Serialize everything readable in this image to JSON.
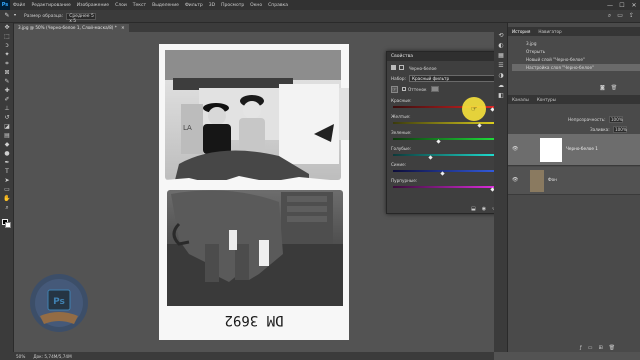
{
  "menubar": {
    "logo": "Ps",
    "items": [
      "Файл",
      "Редактирование",
      "Изображение",
      "Слои",
      "Текст",
      "Выделение",
      "Фильтр",
      "3D",
      "Просмотр",
      "Окно",
      "Справка"
    ],
    "window_controls": [
      "—",
      "☐",
      "✕"
    ]
  },
  "optionsbar": {
    "size_label": "Размер образца:",
    "size_value": "Среднее 5 x 5"
  },
  "document_tab": {
    "title": "3.jpg @ 50% (Черно-белое 1, Слой-маска/8) *",
    "close": "✕"
  },
  "properties": {
    "title": "Свойства",
    "close": "✕",
    "layer_type": "Черно-белое",
    "preset_label": "Набор:",
    "preset_value": "Красный фильтр",
    "tint_label": "Оттенок",
    "auto_label": "Авто",
    "sliders": [
      {
        "label": "Красные:",
        "value": "121",
        "gradient": [
          "#3a0d0d",
          "#ff2a2a"
        ],
        "fraction": 0.8
      },
      {
        "label": "Желтые:",
        "value": "110",
        "gradient": [
          "#3a3a0d",
          "#ffee22"
        ],
        "fraction": 0.7
      },
      {
        "label": "Зеленые:",
        "value": "-10",
        "gradient": [
          "#0d3a0d",
          "#22ff44"
        ],
        "fraction": 0.37
      },
      {
        "label": "Голубые:",
        "value": "-50",
        "gradient": [
          "#0d3a3a",
          "#22ffee"
        ],
        "fraction": 0.3
      },
      {
        "label": "Синие:",
        "value": "0",
        "gradient": [
          "#0d0d3a",
          "#3a6bff"
        ],
        "fraction": 0.4
      },
      {
        "label": "Пурпурные:",
        "value": "120",
        "gradient": [
          "#3a0d3a",
          "#ff33ff"
        ],
        "fraction": 0.8
      }
    ],
    "cursor_color": "#f7e23b"
  },
  "history": {
    "tabs": [
      "История",
      "Навигатор"
    ],
    "snapshot": "3.jpg",
    "items": [
      "Открыть",
      "Новый слой \"Черно-белое\"",
      "Настройка слоя \"Черно-белое\""
    ]
  },
  "layers": {
    "tabs": [
      "Каналы",
      "Контуры"
    ],
    "opacity_label": "Непрозрачность:",
    "opacity_value": "100%",
    "fill_label": "Заливка:",
    "fill_value": "100%",
    "adjustment_layer_name": "Черно-белое 1",
    "background_layer_name": "Фон"
  },
  "status": {
    "zoom": "50%",
    "doc_info": "Док: 5,74М/5,74М"
  },
  "photo": {
    "caption": "DM 3692"
  },
  "colors": {
    "accent": "#31a8ff",
    "ps_bg": "#001e36"
  }
}
